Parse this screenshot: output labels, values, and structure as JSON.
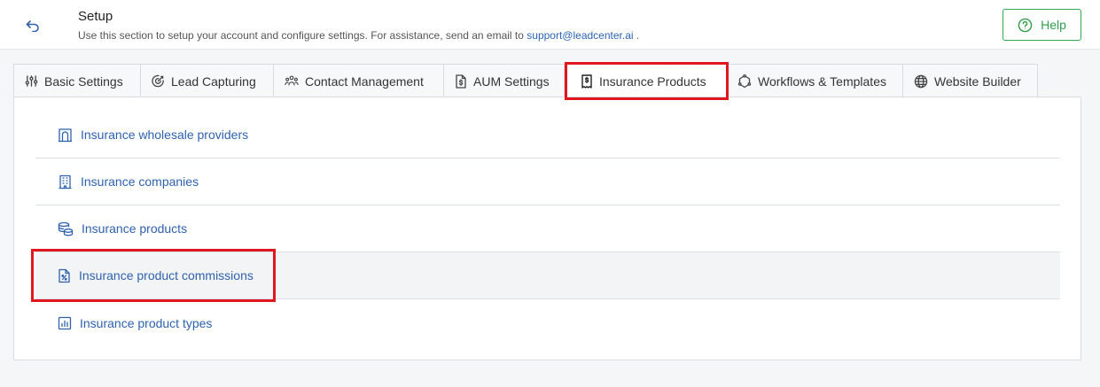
{
  "header": {
    "title": "Setup",
    "subtitle_prefix": "Use this section to setup your account and configure settings. For assistance, send an email to ",
    "support_email": "support@leadcenter.ai",
    "subtitle_suffix": " .",
    "help_label": "Help"
  },
  "tabs": [
    {
      "label": "Basic Settings",
      "icon": "sliders-icon"
    },
    {
      "label": "Lead Capturing",
      "icon": "target-icon"
    },
    {
      "label": "Contact Management",
      "icon": "users-icon"
    },
    {
      "label": "AUM Settings",
      "icon": "dollar-file-icon"
    },
    {
      "label": "Insurance Products",
      "icon": "receipt-icon",
      "active": true
    },
    {
      "label": "Workflows & Templates",
      "icon": "workflow-icon"
    },
    {
      "label": "Website Builder",
      "icon": "globe-icon"
    }
  ],
  "items": [
    {
      "label": "Insurance wholesale providers",
      "icon": "building-arch-icon"
    },
    {
      "label": "Insurance companies",
      "icon": "office-building-icon"
    },
    {
      "label": "Insurance products",
      "icon": "coins-icon"
    },
    {
      "label": "Insurance product commissions",
      "icon": "file-percent-icon"
    },
    {
      "label": "Insurance product types",
      "icon": "chart-icon"
    }
  ],
  "colors": {
    "accent": "#2e62ad",
    "help_green": "#34a853",
    "highlight": "#e0171f"
  }
}
